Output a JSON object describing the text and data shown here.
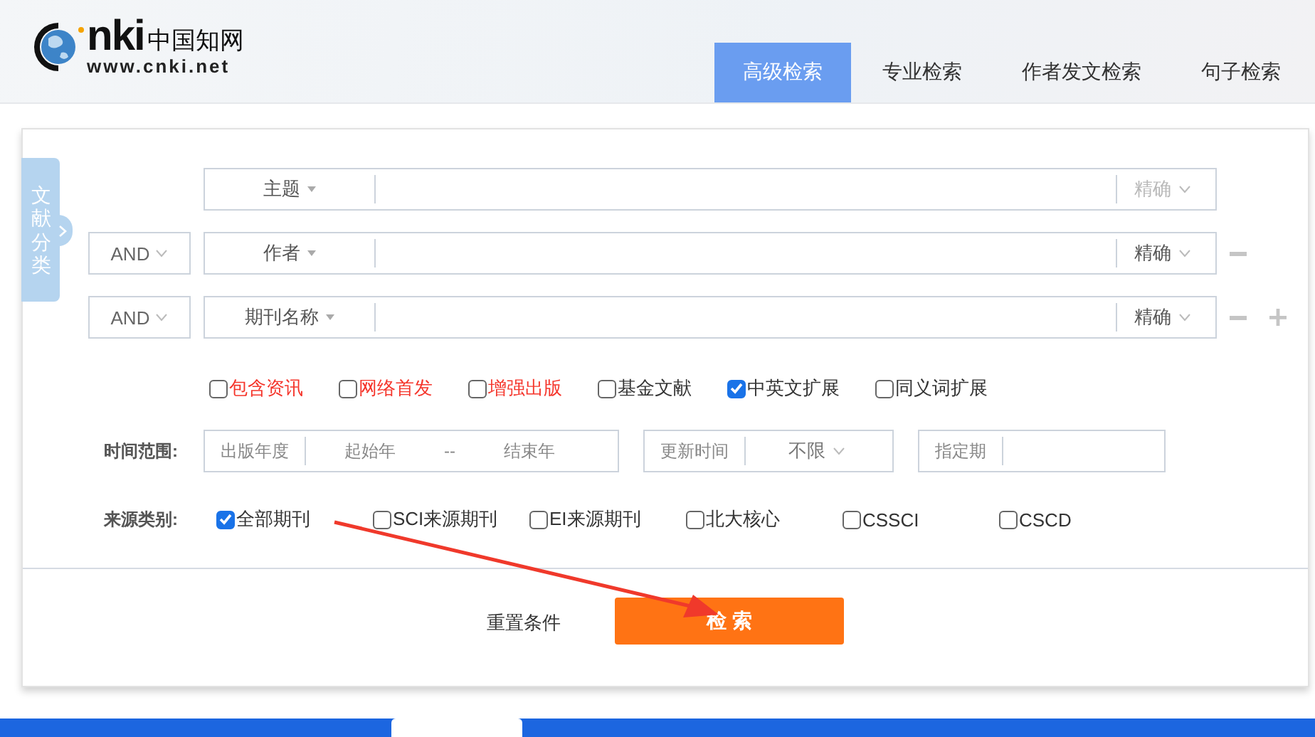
{
  "logo": {
    "mark": "nki",
    "name": "中国知网",
    "url": "www.cnki.net"
  },
  "tabs": [
    {
      "label": "高级检索",
      "selected": true
    },
    {
      "label": "专业检索",
      "selected": false
    },
    {
      "label": "作者发文检索",
      "selected": false
    },
    {
      "label": "句子检索",
      "selected": false
    }
  ],
  "side_tab": {
    "label": "文献分类"
  },
  "search_rows": [
    {
      "field": "主题",
      "match": "精确",
      "disabled": true,
      "removable": false,
      "addable": false
    },
    {
      "operator": "AND",
      "field": "作者",
      "match": "精确",
      "disabled": false,
      "removable": true,
      "addable": false
    },
    {
      "operator": "AND",
      "field": "期刊名称",
      "match": "精确",
      "disabled": false,
      "removable": true,
      "addable": true
    }
  ],
  "options": [
    {
      "label": "包含资讯",
      "checked": false,
      "color": "#f5352b"
    },
    {
      "label": "网络首发",
      "checked": false,
      "color": "#f5352b"
    },
    {
      "label": "增强出版",
      "checked": false,
      "color": "#f5352b"
    },
    {
      "label": "基金文献",
      "checked": false,
      "color": "#333333"
    },
    {
      "label": "中英文扩展",
      "checked": true,
      "color": "#333333"
    },
    {
      "label": "同义词扩展",
      "checked": false,
      "color": "#333333"
    }
  ],
  "time_range": {
    "label": "时间范围:",
    "type": "出版年度",
    "start_placeholder": "起始年",
    "separator": "--",
    "end_placeholder": "结束年",
    "update_label": "更新时间",
    "update_value": "不限",
    "period_label": "指定期"
  },
  "source": {
    "label": "来源类别:",
    "items": [
      {
        "label": "全部期刊",
        "checked": true
      },
      {
        "label": "SCI来源期刊",
        "checked": false
      },
      {
        "label": "EI来源期刊",
        "checked": false
      },
      {
        "label": "北大核心",
        "checked": false
      },
      {
        "label": "CSSCI",
        "checked": false
      },
      {
        "label": "CSCD",
        "checked": false
      }
    ]
  },
  "buttons": {
    "reset": "重置条件",
    "search": "检 索"
  }
}
